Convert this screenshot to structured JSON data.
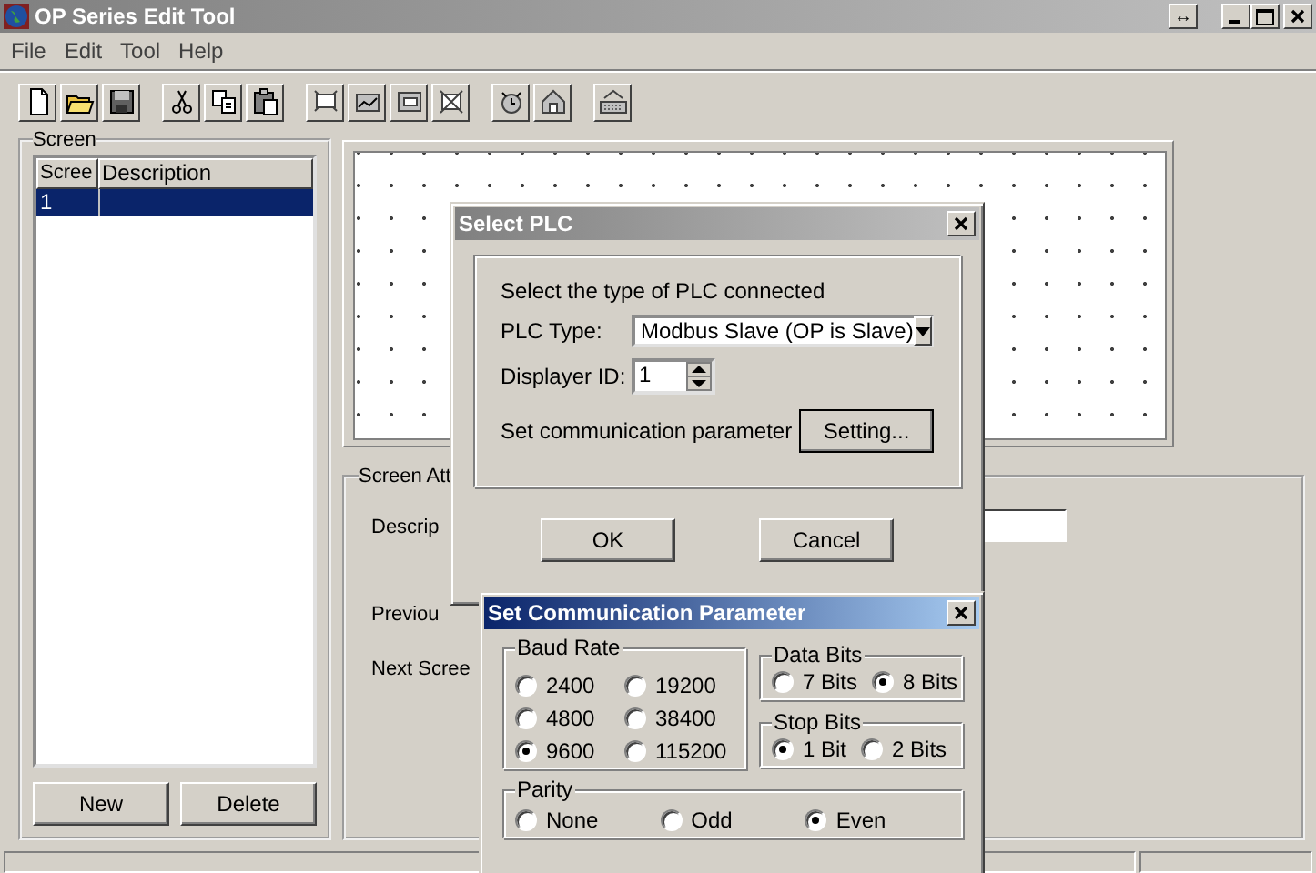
{
  "window": {
    "title": "OP Series Edit Tool",
    "resize_glyph": "↔"
  },
  "menu": [
    "File",
    "Edit",
    "Tool",
    "Help"
  ],
  "screen_panel": {
    "title": "Screen",
    "columns": [
      "Scree",
      "Description"
    ],
    "rows": [
      {
        "number": "1",
        "selected": true
      }
    ],
    "buttons": [
      "New",
      "Delete"
    ]
  },
  "screen_attributes": {
    "title": "Screen Att",
    "labels": [
      "Descrip",
      "Previou",
      "Next Scree"
    ]
  },
  "select_plc": {
    "title": "Select PLC",
    "prompt": "Select the type of PLC connected",
    "plc_type_label": "PLC Type:",
    "plc_type_value": "Modbus Slave (OP is Slave)",
    "id_label": "Displayer ID:",
    "id_value": "1",
    "comm_label": "Set communication parameter",
    "setting_button": "Setting...",
    "buttons": [
      "OK",
      "Cancel"
    ]
  },
  "comm_dialog": {
    "title": "Set Communication Parameter",
    "baud_rate": {
      "title": "Baud Rate",
      "options": [
        {
          "label": "2400",
          "selected": false
        },
        {
          "label": "19200",
          "selected": false
        },
        {
          "label": "4800",
          "selected": false
        },
        {
          "label": "38400",
          "selected": false
        },
        {
          "label": "9600",
          "selected": true
        },
        {
          "label": "115200",
          "selected": false
        }
      ]
    },
    "data_bits": {
      "title": "Data Bits",
      "options": [
        {
          "label": "7 Bits",
          "selected": false
        },
        {
          "label": "8 Bits",
          "selected": true
        }
      ]
    },
    "stop_bits": {
      "title": "Stop Bits",
      "options": [
        {
          "label": "1 Bit",
          "selected": true
        },
        {
          "label": "2 Bits",
          "selected": false
        }
      ]
    },
    "parity": {
      "title": "Parity",
      "options": [
        {
          "label": "None",
          "selected": false
        },
        {
          "label": "Odd",
          "selected": false
        },
        {
          "label": "Even",
          "selected": true
        }
      ]
    }
  }
}
